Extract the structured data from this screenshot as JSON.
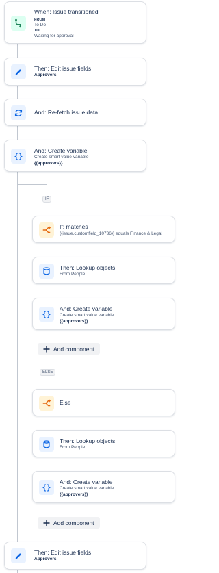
{
  "colors": {
    "green_icon": "#1f845a",
    "blue_icon": "#0c66e4",
    "orange_icon": "#e56910",
    "connector": "#c1c7d0"
  },
  "trigger": {
    "icon": "branch-icon",
    "title": "When: Issue transitioned",
    "from_label": "FROM",
    "from_value": "To Do",
    "to_label": "TO",
    "to_value": "Waiting for approval"
  },
  "step_edit_1": {
    "icon": "pencil-icon",
    "title": "Then: Edit issue fields",
    "detail": "Approvers"
  },
  "step_refetch": {
    "icon": "refresh-icon",
    "title": "And: Re-fetch issue data"
  },
  "step_var_1": {
    "icon": "braces-icon",
    "title": "And: Create variable",
    "detail": "Create smart value variable",
    "value": "{{approvers}}"
  },
  "branch_if": {
    "tag": "IF",
    "condition": {
      "icon": "condition-icon",
      "title": "If: matches",
      "detail": "{{issue.customfield_10736}} equals Finance & Legal"
    },
    "lookup": {
      "icon": "database-icon",
      "title": "Then: Lookup objects",
      "detail": "From People"
    },
    "variable": {
      "icon": "braces-icon",
      "title": "And: Create variable",
      "detail": "Create smart value variable",
      "value": "{{approvers}}"
    },
    "add_component": "Add component"
  },
  "branch_else": {
    "tag": "ELSE",
    "condition": {
      "icon": "condition-icon",
      "title": "Else"
    },
    "lookup": {
      "icon": "database-icon",
      "title": "Then: Lookup objects",
      "detail": "From People"
    },
    "variable": {
      "icon": "braces-icon",
      "title": "And: Create variable",
      "detail": "Create smart value variable",
      "value": "{{approvers}}"
    },
    "add_component": "Add component"
  },
  "step_edit_2": {
    "icon": "pencil-icon",
    "title": "Then: Edit issue fields",
    "detail": "Approvers"
  }
}
